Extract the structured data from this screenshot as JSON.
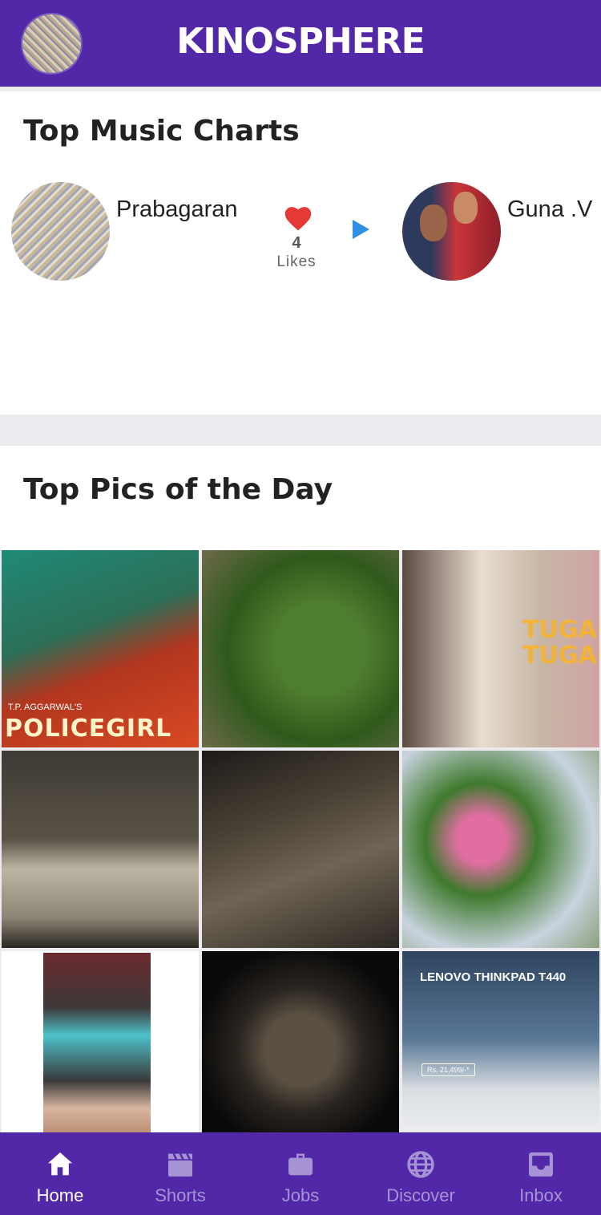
{
  "app": {
    "brand": "KINOSPHERE",
    "profile_avatar_icon": "profile-avatar"
  },
  "music_charts": {
    "title": "Top Music Charts",
    "entries": [
      {
        "name": "Prabagaran",
        "likes": "4",
        "likes_label": "Likes"
      },
      {
        "name": "Guna .V"
      }
    ],
    "colors": {
      "heart": "#e53935",
      "play": "#2f8fe6"
    }
  },
  "top_pics": {
    "title": "Top Pics of the Day",
    "images": [
      {
        "alt": "Policegirl movie poster",
        "caption_top": "T.P. AGGARWAL'S",
        "caption": "POLICEGIRL"
      },
      {
        "alt": "Mushrooms in grass"
      },
      {
        "alt": "Tugal Tugal poster",
        "caption": "TUGAL TUGAL"
      },
      {
        "alt": "Vintage radio close-up"
      },
      {
        "alt": "Vintage radio angled"
      },
      {
        "alt": "Pink and white flowers"
      },
      {
        "alt": "Man in teal blazer"
      },
      {
        "alt": "Vintage radio on black"
      },
      {
        "alt": "Lenovo Thinkpad T440 ad",
        "caption": "LENOVO THINKPAD T440",
        "price": "Rs. 21,499/-*"
      }
    ]
  },
  "bottom_nav": {
    "items": [
      {
        "label": "Home",
        "icon": "home-icon",
        "active": true
      },
      {
        "label": "Shorts",
        "icon": "clapperboard-icon"
      },
      {
        "label": "Jobs",
        "icon": "briefcase-icon"
      },
      {
        "label": "Discover",
        "icon": "globe-icon"
      },
      {
        "label": "Inbox",
        "icon": "inbox-icon"
      }
    ],
    "colors": {
      "background": "#5228a8",
      "active": "#ffffff",
      "inactive": "#a593d6"
    }
  }
}
